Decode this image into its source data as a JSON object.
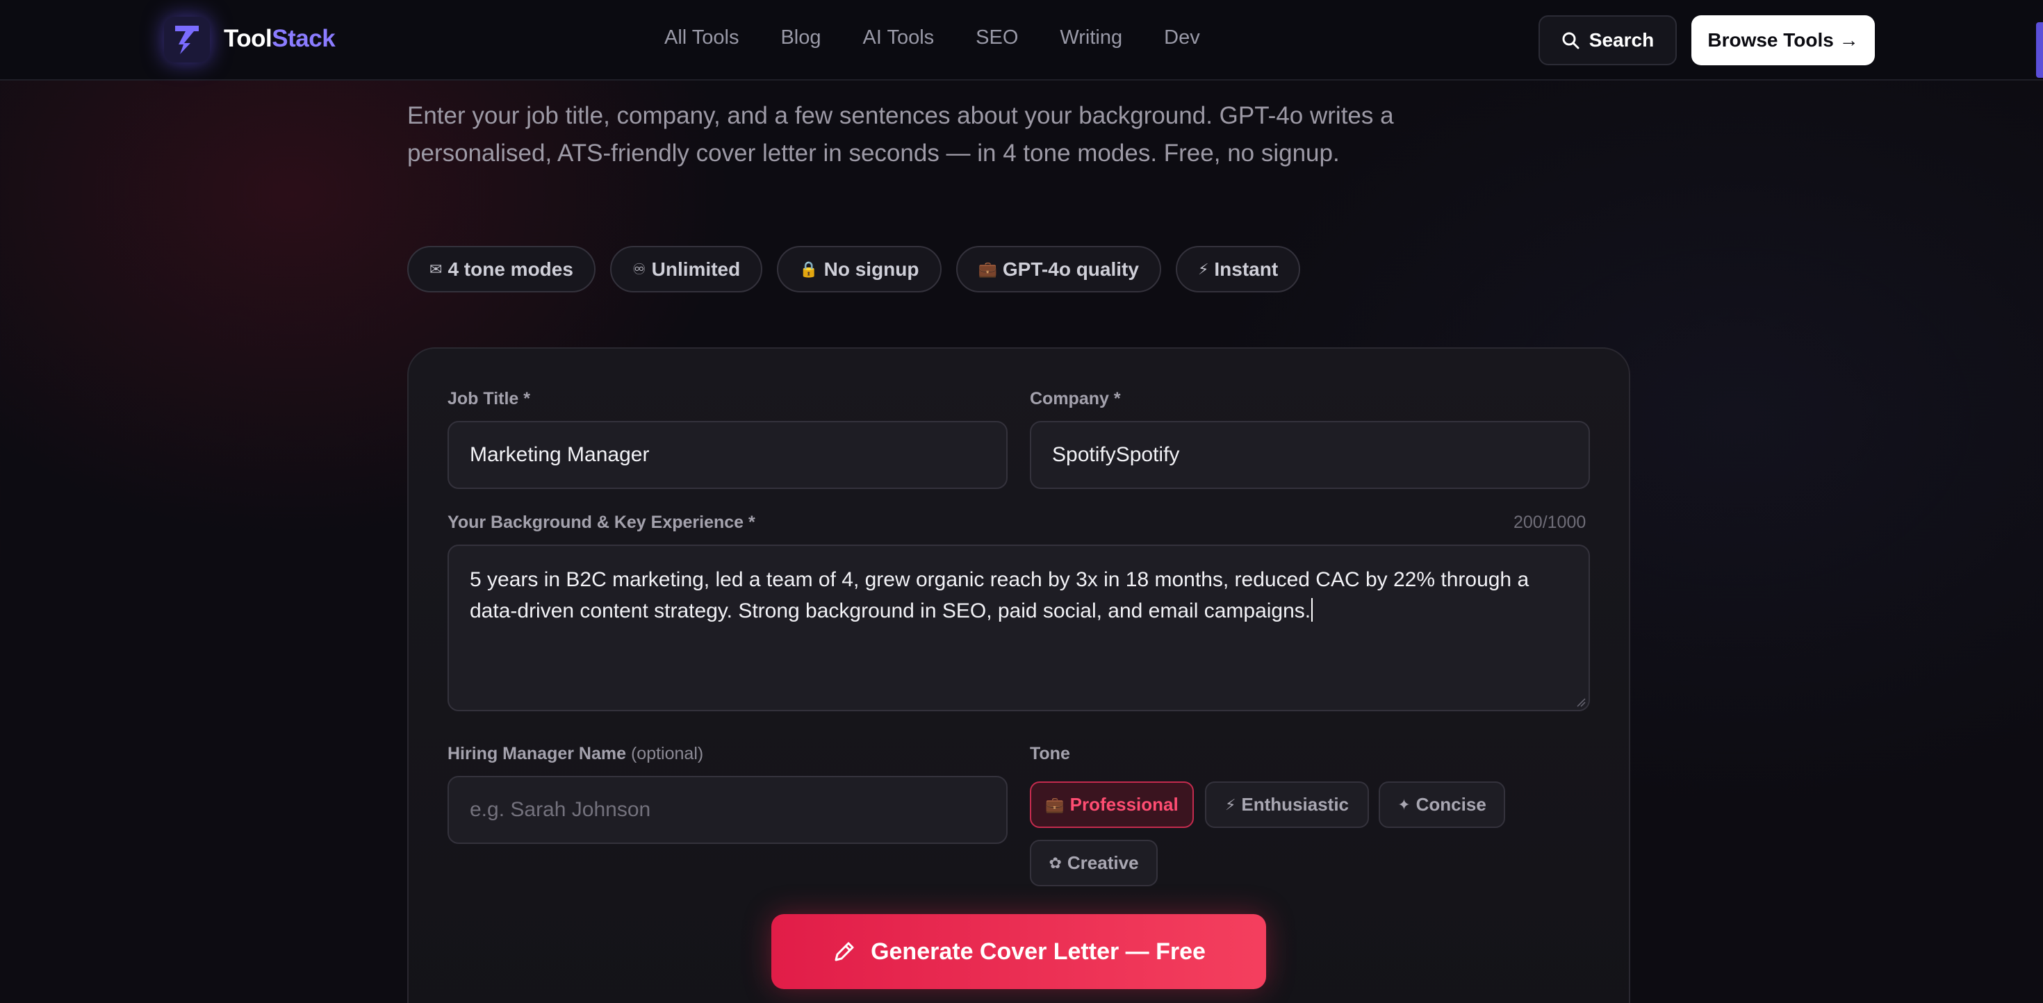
{
  "nav": {
    "brand_tool": "Tool",
    "brand_stack": "Stack",
    "links": [
      "All Tools",
      "Blog",
      "AI Tools",
      "SEO",
      "Writing",
      "Dev"
    ],
    "search_label": "Search",
    "browse_label": "Browse Tools →"
  },
  "intro": {
    "description": "Enter your job title, company, and a few sentences about your background. GPT-4o writes a personalised, ATS-friendly cover letter in seconds — in 4 tone modes. Free, no signup."
  },
  "pills": [
    {
      "icon": "✉",
      "label": "4 tone modes"
    },
    {
      "icon": "♾",
      "label": "Unlimited"
    },
    {
      "icon": "🔒",
      "label": "No signup"
    },
    {
      "icon": "💼",
      "label": "GPT-4o quality"
    },
    {
      "icon": "⚡",
      "label": "Instant"
    }
  ],
  "form": {
    "job_title_label": "Job Title *",
    "job_title_value": "Marketing Manager",
    "company_label": "Company *",
    "company_value": "SpotifySpotify",
    "background_label": "Your Background & Key Experience *",
    "background_counter": "200/1000",
    "background_value": "5 years in B2C marketing, led a team of 4, grew organic reach by 3x in 18 months, reduced CAC by 22% through a data-driven content strategy. Strong background in SEO, paid social, and email campaigns.",
    "hiring_manager_label": "Hiring Manager Name",
    "hiring_manager_optional": "(optional)",
    "hiring_manager_placeholder": "e.g. Sarah Johnson",
    "tone_label": "Tone",
    "tones": [
      {
        "icon": "💼",
        "label": "Professional",
        "selected": true
      },
      {
        "icon": "⚡",
        "label": "Enthusiastic",
        "selected": false
      },
      {
        "icon": "✦",
        "label": "Concise",
        "selected": false
      },
      {
        "icon": "✿",
        "label": "Creative",
        "selected": false
      }
    ],
    "generate_label": "Generate Cover Letter — Free"
  },
  "colors": {
    "brand_accent": "#8b7cff",
    "primary_red": "#e11d48",
    "background": "#0d0c12"
  }
}
